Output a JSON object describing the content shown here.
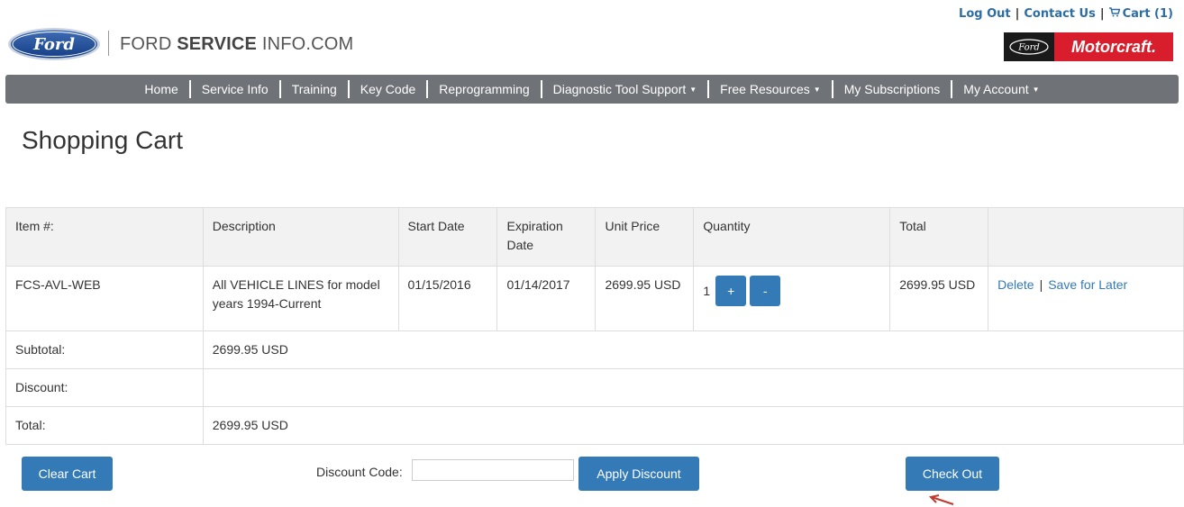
{
  "header": {
    "links": {
      "logout": "Log Out",
      "contact": "Contact Us",
      "cart": "Cart (1)"
    },
    "logo": {
      "ford_icon": "ford-oval-logo",
      "brand_prefix": "FORD ",
      "brand_bold": "SERVICE",
      "brand_suffix": " INFO.COM"
    },
    "motorcraft": {
      "label": "Motorcraft."
    }
  },
  "nav": {
    "items": [
      {
        "label": "Home",
        "dropdown": false
      },
      {
        "label": "Service Info",
        "dropdown": false
      },
      {
        "label": "Training",
        "dropdown": false
      },
      {
        "label": "Key Code",
        "dropdown": false
      },
      {
        "label": "Reprogramming",
        "dropdown": false
      },
      {
        "label": "Diagnostic Tool Support",
        "dropdown": true
      },
      {
        "label": "Free Resources",
        "dropdown": true
      },
      {
        "label": "My Subscriptions",
        "dropdown": false
      },
      {
        "label": "My Account",
        "dropdown": true
      }
    ]
  },
  "page": {
    "title": "Shopping Cart"
  },
  "table": {
    "headers": [
      "Item #:",
      "Description",
      "Start Date",
      "Expiration Date",
      "Unit Price",
      "Quantity",
      "Total",
      ""
    ],
    "item": {
      "item_no": "FCS-AVL-WEB",
      "description": "All VEHICLE LINES for model years 1994-Current",
      "start_date": "01/15/2016",
      "expiration_date": "01/14/2017",
      "unit_price": "2699.95 USD",
      "quantity": "1",
      "plus": "+",
      "minus": "-",
      "total": "2699.95 USD",
      "delete": "Delete",
      "save_later": "Save for Later"
    },
    "subtotal_label": "Subtotal:",
    "subtotal_value": "2699.95 USD",
    "discount_label": "Discount:",
    "discount_value": "",
    "total_label": "Total:",
    "total_value": "2699.95 USD"
  },
  "controls": {
    "clear_cart": "Clear Cart",
    "discount_code_label": "Discount Code:",
    "discount_code_value": "",
    "apply_discount": "Apply Discount",
    "check_out": "Check Out"
  },
  "colors": {
    "nav_bg": "#6f7377",
    "primary_button": "#337ab7",
    "link": "#2e6da4",
    "motorcraft_red": "#d81e2c",
    "arrow": "#c0392b"
  }
}
